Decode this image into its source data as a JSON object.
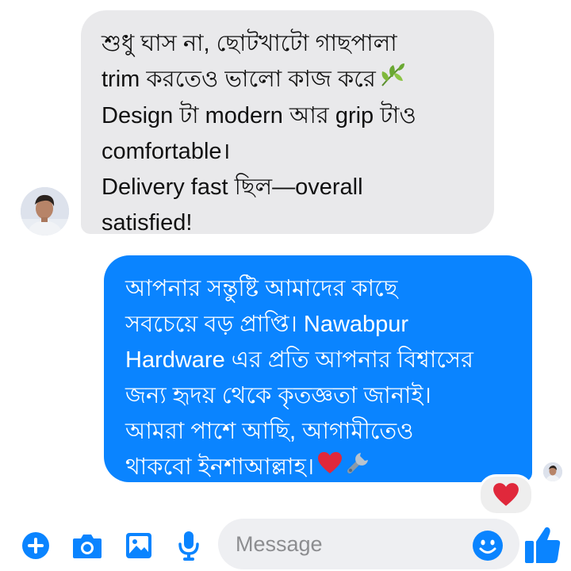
{
  "conversation": {
    "incoming": {
      "lines": [
        "শুধু ঘাস না, ছোটখাটো গাছপালা",
        "trim করতেও ভালো কাজ করে",
        "Design টা modern আর grip টাও",
        "comfortable।",
        "Delivery fast ছিল—overall",
        "satisfied!"
      ],
      "inline_emoji": "leaf-emoji"
    },
    "outgoing": {
      "lines": [
        "আপনার সন্তুষ্টি আমাদের কাছে",
        "সবচেয়ে বড় প্রাপ্তি। Nawabpur",
        "Hardware এর প্রতি আপনার বিশ্বাসের",
        "জন্য হৃদয় থেকে কৃতজ্ঞতা জানাই।",
        "আমরা পাশে আছি, আগামীতেও",
        "থাকবো ইনশাআল্লাহ।"
      ],
      "inline_emojis": [
        "red-heart-emoji",
        "wrench-emoji"
      ],
      "reaction": "red-heart-emoji"
    }
  },
  "composer": {
    "placeholder": "Message",
    "icons": [
      "plus-icon",
      "camera-icon",
      "image-icon",
      "microphone-icon",
      "emoji-icon",
      "thumbs-up-icon"
    ]
  },
  "colors": {
    "incoming_bubble": "#e9e9eb",
    "outgoing_bubble": "#0a84ff",
    "accent": "#0a84ff",
    "heart": "#e0283b"
  }
}
